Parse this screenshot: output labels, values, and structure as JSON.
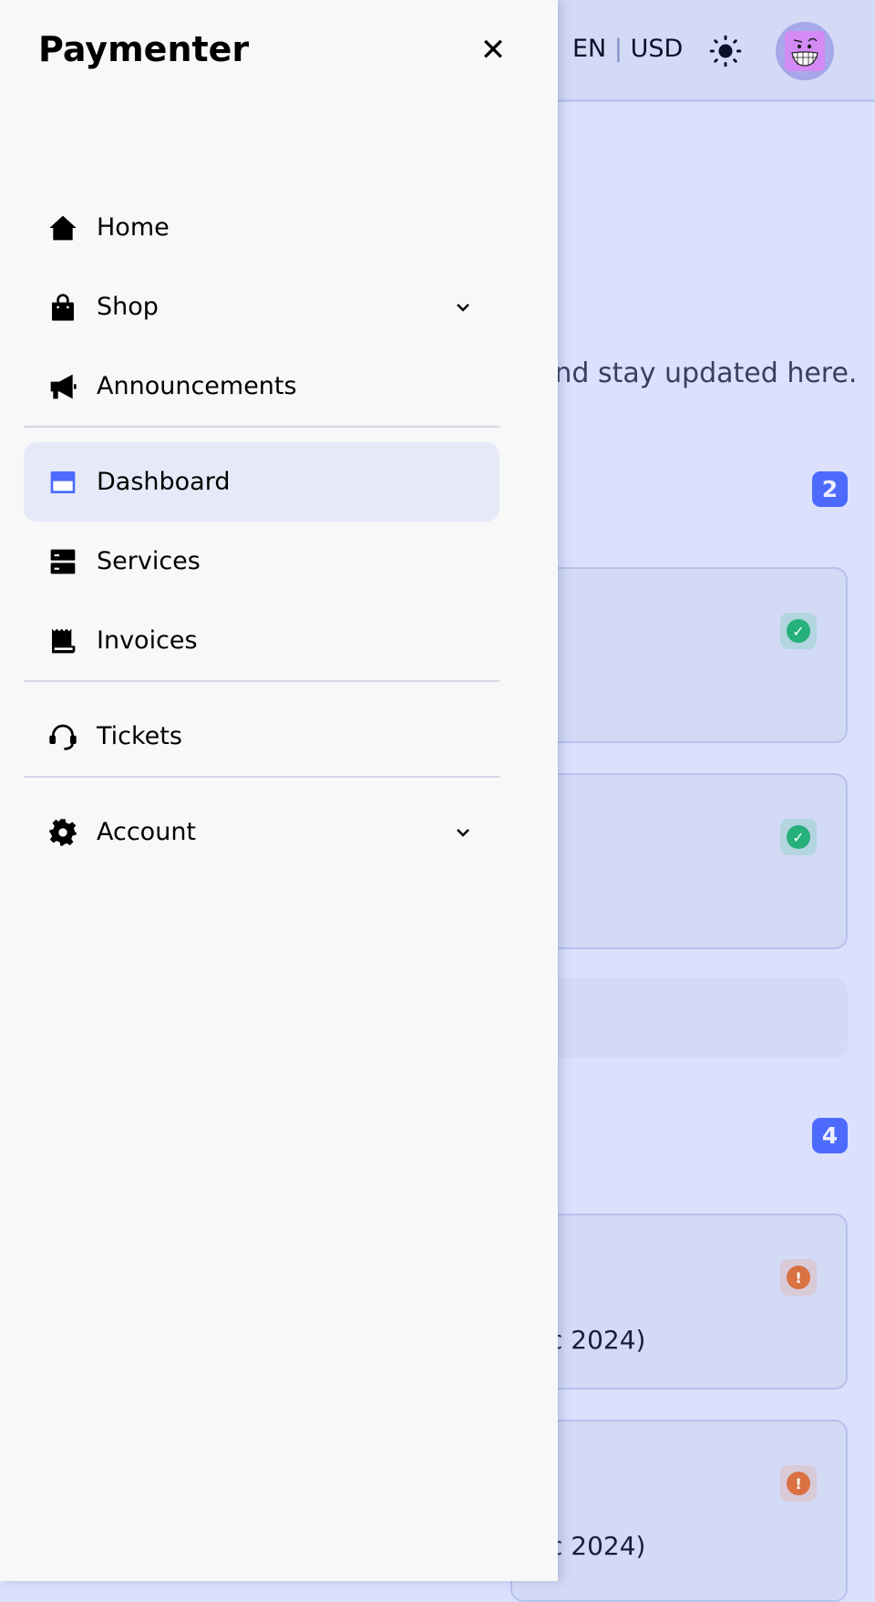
{
  "header": {
    "language": "EN",
    "separator": "|",
    "currency": "USD",
    "theme_icon": "sun-icon",
    "avatar_icon": "grinning-face-avatar"
  },
  "main": {
    "intro_text": "and stay updated here.",
    "services_count": "2",
    "invoices_count": "4",
    "service_cards": [
      {
        "status": "active",
        "status_color": "#26b07a"
      },
      {
        "status": "active",
        "status_color": "#26b07a"
      }
    ],
    "invoice_cards": [
      {
        "status": "unpaid",
        "status_color": "#d97142",
        "text": "c 2024)"
      },
      {
        "status": "unpaid",
        "status_color": "#d97142",
        "text": "c 2024)"
      }
    ],
    "accent_color": "#4c6bfd"
  },
  "sidebar": {
    "title": "Paymenter",
    "close_icon": "close-icon",
    "items": [
      {
        "label": "Home",
        "icon": "home-icon"
      },
      {
        "label": "Shop",
        "icon": "shopping-bag-icon",
        "has_children": true
      },
      {
        "label": "Announcements",
        "icon": "megaphone-icon"
      },
      {
        "label": "Dashboard",
        "icon": "dashboard-icon",
        "active": true
      },
      {
        "label": "Services",
        "icon": "server-icon"
      },
      {
        "label": "Invoices",
        "icon": "receipt-icon"
      },
      {
        "label": "Tickets",
        "icon": "headset-icon"
      },
      {
        "label": "Account",
        "icon": "gear-icon",
        "has_children": true
      }
    ]
  }
}
